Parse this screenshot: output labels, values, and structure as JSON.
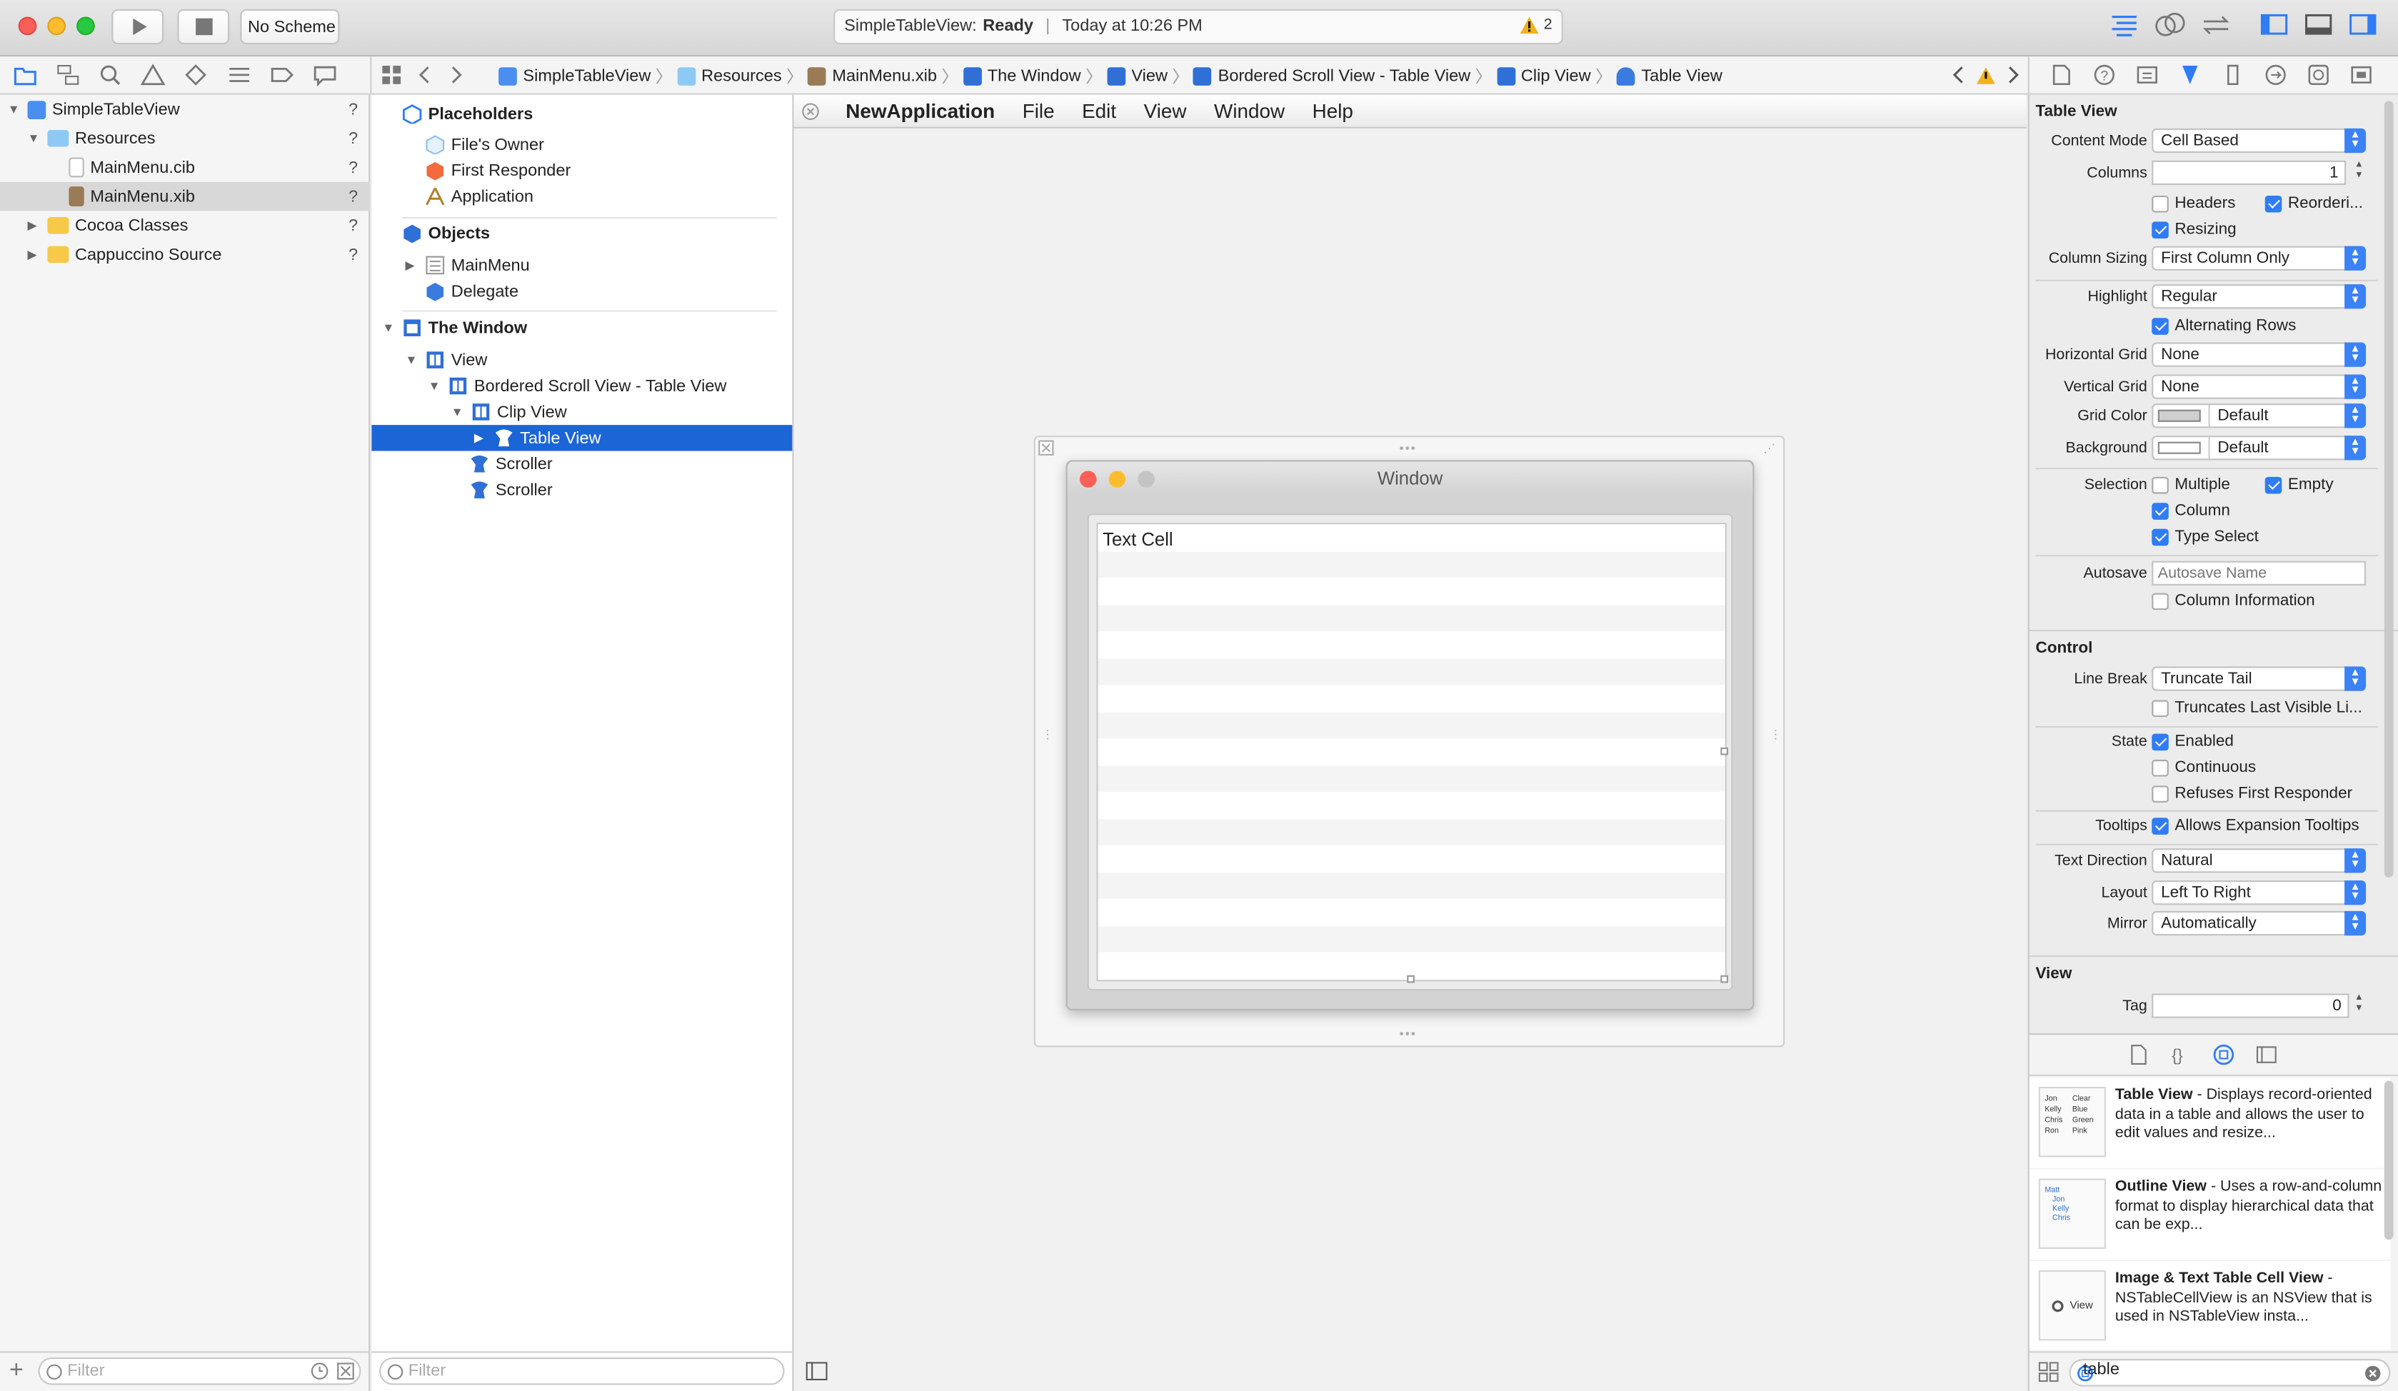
{
  "toolbar": {
    "scheme": "No Scheme",
    "activity_project": "SimpleTableView:",
    "activity_status": "Ready",
    "activity_time": "Today at 10:26 PM",
    "warning_count": "2"
  },
  "jumpbar": {
    "crumbs": [
      "SimpleTableView",
      "Resources",
      "MainMenu.xib",
      "The Window",
      "View",
      "Bordered Scroll View - Table View",
      "Clip View",
      "Table View"
    ]
  },
  "navigator": {
    "items": [
      {
        "label": "SimpleTableView",
        "status": "?"
      },
      {
        "label": "Resources",
        "status": "?"
      },
      {
        "label": "MainMenu.cib",
        "status": "?"
      },
      {
        "label": "MainMenu.xib",
        "status": "?"
      },
      {
        "label": "Cocoa Classes",
        "status": "?"
      },
      {
        "label": "Cappuccino Source",
        "status": "?"
      }
    ],
    "filter_placeholder": "Filter"
  },
  "outline": {
    "placeholders_header": "Placeholders",
    "placeholders": [
      "File's Owner",
      "First Responder",
      "Application"
    ],
    "objects_header": "Objects",
    "objects": [
      "MainMenu",
      "Delegate"
    ],
    "window_header": "The Window",
    "window_items": [
      "View",
      "Bordered Scroll View - Table View",
      "Clip View",
      "Table View",
      "Scroller",
      "Scroller"
    ],
    "filter_placeholder": "Filter"
  },
  "canvas": {
    "app_name": "NewApplication",
    "menus": [
      "File",
      "Edit",
      "View",
      "Window",
      "Help"
    ],
    "window_title": "Window",
    "first_cell": "Text Cell"
  },
  "inspector": {
    "title": "Table View",
    "content_mode_label": "Content Mode",
    "content_mode": "Cell Based",
    "columns_label": "Columns",
    "columns": "1",
    "headers": "Headers",
    "reordering": "Reorderi...",
    "resizing": "Resizing",
    "column_sizing_label": "Column Sizing",
    "column_sizing": "First Column Only",
    "highlight_label": "Highlight",
    "highlight": "Regular",
    "alternating_rows": "Alternating Rows",
    "hgrid_label": "Horizontal Grid",
    "hgrid": "None",
    "vgrid_label": "Vertical Grid",
    "vgrid": "None",
    "grid_color_label": "Grid Color",
    "grid_color": "Default",
    "background_label": "Background",
    "background": "Default",
    "selection_label": "Selection",
    "multiple": "Multiple",
    "empty": "Empty",
    "column": "Column",
    "type_select": "Type Select",
    "autosave_label": "Autosave",
    "autosave_placeholder": "Autosave Name",
    "column_information": "Column Information",
    "control_header": "Control",
    "line_break_label": "Line Break",
    "line_break": "Truncate Tail",
    "truncates_last": "Truncates Last Visible Li...",
    "state_label": "State",
    "enabled": "Enabled",
    "continuous": "Continuous",
    "refuses_first": "Refuses First Responder",
    "tooltips_label": "Tooltips",
    "allows_expansion": "Allows Expansion Tooltips",
    "text_direction_label": "Text Direction",
    "text_direction": "Natural",
    "layout_label": "Layout",
    "layout": "Left To Right",
    "mirror_label": "Mirror",
    "mirror": "Automatically",
    "view_header": "View",
    "tag_label": "Tag",
    "tag": "0"
  },
  "library": {
    "items": [
      {
        "title": "Table View",
        "desc": " - Displays record-oriented data in a table and allows the user to edit values and resize..."
      },
      {
        "title": "Outline View",
        "desc": " - Uses a row-and-column format to display hierarchical data that can be exp..."
      },
      {
        "title": "Image & Text Table Cell View",
        "desc": " - NSTableCellView is an NSView that is used in NSTableView insta..."
      }
    ],
    "thumb_tv": [
      "Jon",
      "Clear",
      "Kelly",
      "Blue",
      "Chris",
      "Green",
      "Ron",
      "Pink"
    ],
    "thumb_ov": [
      "Matt",
      "Jon",
      "Kelly",
      "Chris"
    ],
    "thumb_view": "View",
    "search_value": "table"
  }
}
